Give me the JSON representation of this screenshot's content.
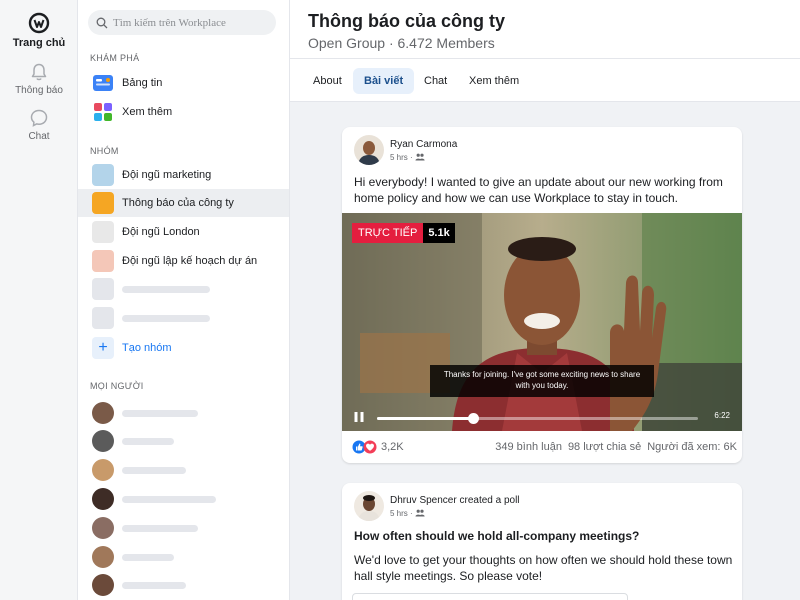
{
  "rail": {
    "home_label": "Trang chủ",
    "notifications_label": "Thông báo",
    "chat_label": "Chat"
  },
  "sidebar": {
    "search_placeholder": "Tìm kiếm trên Workplace",
    "explore_title": "KHÁM PHÁ",
    "explore_items": [
      {
        "label": "Bảng tin",
        "icon": "news-feed-icon"
      },
      {
        "label": "Xem thêm",
        "icon": "see-more-icon"
      }
    ],
    "groups_title": "NHÓM",
    "groups": [
      {
        "label": "Đội ngũ marketing",
        "color": "#b3d4ea"
      },
      {
        "label": "Thông báo của công ty",
        "color": "#f5a623"
      },
      {
        "label": "Đội ngũ London",
        "color": "#e8e8e8"
      },
      {
        "label": "Đội ngũ lập kế hoạch dự án",
        "color": "#f4c7b8"
      }
    ],
    "create_group_label": "Tạo nhóm",
    "people_title": "MỌI NGƯỜI"
  },
  "group": {
    "title": "Thông báo của công ty",
    "subtitle": "Open Group · 6.472 Members"
  },
  "tabs": [
    "About",
    "Bài viết",
    "Chat",
    "Xem thêm"
  ],
  "active_tab": 1,
  "post": {
    "author": "Ryan Carmona",
    "time": "5 hrs ·",
    "text": "Hi everybody! I wanted to give an update about our new working from home policy and how we can use Workplace to stay in touch.",
    "live_label": "TRỰC TIẾP",
    "viewers": "5.1k",
    "caption": "Thanks for joining. I've got some exciting news to share with you today.",
    "video_time": "6:22",
    "progress_fraction": 0.3,
    "reactions_count": "3,2K",
    "comments": "349 bình luận",
    "shares": "98 lượt chia sẻ",
    "seen": "Người đã xem: 6K"
  },
  "poll_post": {
    "author": "Dhruv Spencer",
    "action": "created a poll",
    "time": "5 hrs ·",
    "title": "How often should we hold all-company meetings?",
    "text": "We'd love to get your thoughts on how often we should hold these town hall style meetings. So please vote!"
  },
  "colors": {
    "accent": "#1877f2",
    "live_red": "#e41e3f",
    "tab_active_bg": "#e7f0fb"
  }
}
